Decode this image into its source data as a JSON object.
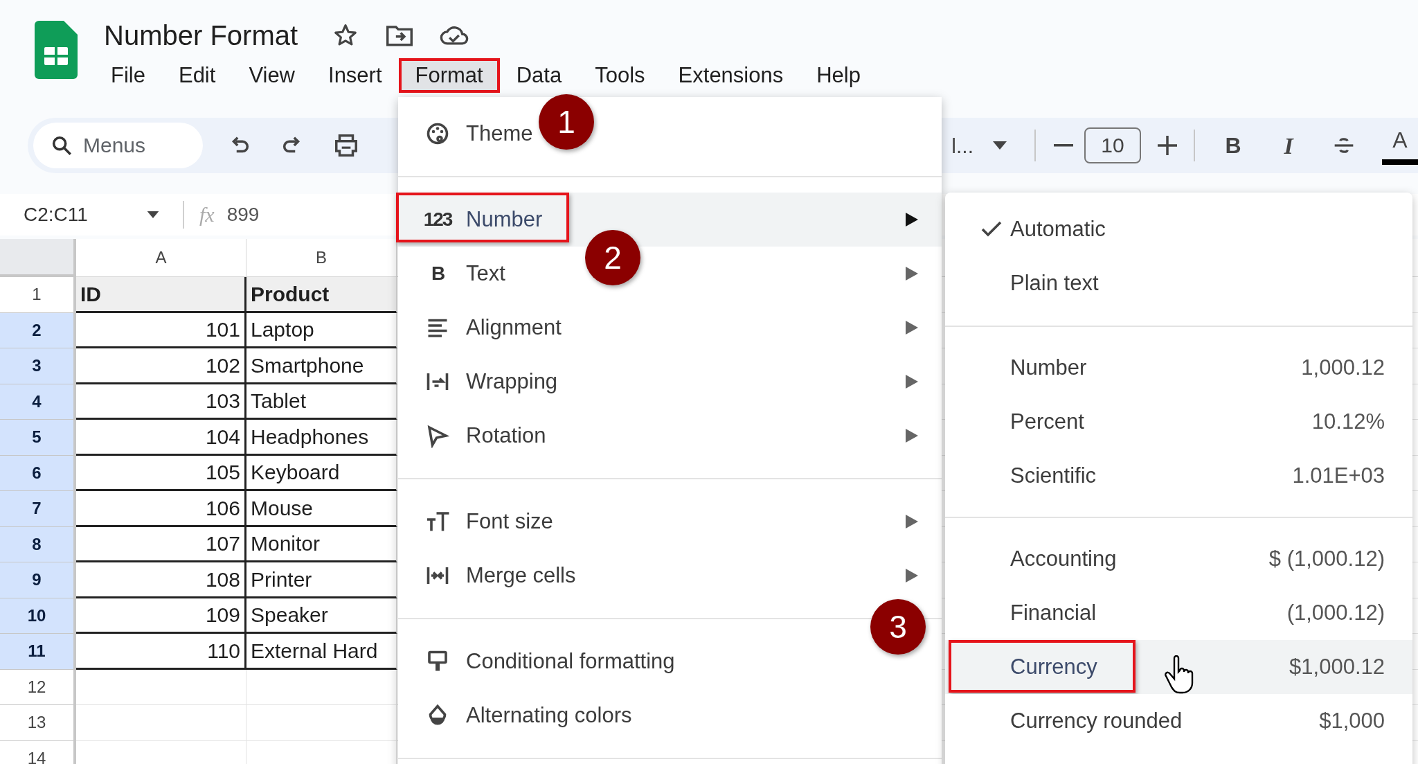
{
  "document": {
    "title": "Number Format"
  },
  "menu_bar": [
    {
      "label": "File",
      "selected": false,
      "highlighted": false
    },
    {
      "label": "Edit",
      "selected": false,
      "highlighted": false
    },
    {
      "label": "View",
      "selected": false,
      "highlighted": false
    },
    {
      "label": "Insert",
      "selected": false,
      "highlighted": false
    },
    {
      "label": "Format",
      "selected": true,
      "highlighted": true
    },
    {
      "label": "Data",
      "selected": false,
      "highlighted": false
    },
    {
      "label": "Tools",
      "selected": false,
      "highlighted": false
    },
    {
      "label": "Extensions",
      "selected": false,
      "highlighted": false
    },
    {
      "label": "Help",
      "selected": false,
      "highlighted": false
    }
  ],
  "toolbar": {
    "search": {
      "placeholder": "Menus"
    },
    "font": {
      "value": "l..."
    },
    "font_size": {
      "value": "10"
    },
    "style_buttons": [
      {
        "kind": "bold",
        "glyph": "B"
      },
      {
        "kind": "italic",
        "glyph": "I"
      },
      {
        "kind": "strikethrough"
      },
      {
        "kind": "text_color",
        "glyph": "A"
      }
    ]
  },
  "formula_bar": {
    "name_box": "C2:C11",
    "fx_label": "fx",
    "formula": "899"
  },
  "sheet": {
    "columns": [
      "A",
      "B"
    ],
    "rows": [
      {
        "number": "1",
        "kind": "header",
        "selected": false,
        "cells": [
          "ID",
          "Product"
        ]
      },
      {
        "number": "2",
        "kind": "data",
        "selected": true,
        "cells": [
          "101",
          "Laptop"
        ]
      },
      {
        "number": "3",
        "kind": "data",
        "selected": true,
        "cells": [
          "102",
          "Smartphone"
        ]
      },
      {
        "number": "4",
        "kind": "data",
        "selected": true,
        "cells": [
          "103",
          "Tablet"
        ]
      },
      {
        "number": "5",
        "kind": "data",
        "selected": true,
        "cells": [
          "104",
          "Headphones"
        ]
      },
      {
        "number": "6",
        "kind": "data",
        "selected": true,
        "cells": [
          "105",
          "Keyboard"
        ]
      },
      {
        "number": "7",
        "kind": "data",
        "selected": true,
        "cells": [
          "106",
          "Mouse"
        ]
      },
      {
        "number": "8",
        "kind": "data",
        "selected": true,
        "cells": [
          "107",
          "Monitor"
        ]
      },
      {
        "number": "9",
        "kind": "data",
        "selected": true,
        "cells": [
          "108",
          "Printer"
        ]
      },
      {
        "number": "10",
        "kind": "data",
        "selected": true,
        "cells": [
          "109",
          "Speaker"
        ]
      },
      {
        "number": "11",
        "kind": "data",
        "selected": true,
        "cells": [
          "110",
          "External Hard"
        ]
      },
      {
        "number": "12",
        "kind": "empty",
        "selected": false
      },
      {
        "number": "13",
        "kind": "empty",
        "selected": false
      },
      {
        "number": "14",
        "kind": "empty",
        "selected": false
      }
    ]
  },
  "format_menu": {
    "sections": [
      [
        {
          "label": "Theme",
          "has_submenu": false,
          "selected": false,
          "highlighted": false
        }
      ],
      [
        {
          "label": "Number",
          "icon_text": "123",
          "has_submenu": true,
          "selected": true,
          "highlighted": true
        },
        {
          "label": "Text",
          "icon_text": "B",
          "has_submenu": true,
          "selected": false,
          "highlighted": false
        },
        {
          "label": "Alignment",
          "has_submenu": true,
          "selected": false,
          "highlighted": false
        },
        {
          "label": "Wrapping",
          "has_submenu": true,
          "selected": false,
          "highlighted": false
        },
        {
          "label": "Rotation",
          "has_submenu": true,
          "selected": false,
          "highlighted": false
        }
      ],
      [
        {
          "label": "Font size",
          "has_submenu": true,
          "selected": false,
          "highlighted": false
        },
        {
          "label": "Merge cells",
          "has_submenu": true,
          "selected": false,
          "highlighted": false
        }
      ],
      [
        {
          "label": "Conditional formatting",
          "has_submenu": false,
          "selected": false,
          "highlighted": false
        },
        {
          "label": "Alternating colors",
          "has_submenu": false,
          "selected": false,
          "highlighted": false
        }
      ]
    ]
  },
  "number_submenu": {
    "sections": [
      [
        {
          "label": "Automatic",
          "checked": true,
          "selected": false,
          "highlighted": false
        },
        {
          "label": "Plain text",
          "checked": false,
          "selected": false,
          "highlighted": false
        }
      ],
      [
        {
          "label": "Number",
          "example": "1,000.12",
          "checked": false,
          "selected": false,
          "highlighted": false
        },
        {
          "label": "Percent",
          "example": "10.12%",
          "checked": false,
          "selected": false,
          "highlighted": false
        },
        {
          "label": "Scientific",
          "example": "1.01E+03",
          "checked": false,
          "selected": false,
          "highlighted": false
        }
      ],
      [
        {
          "label": "Accounting",
          "example": "$ (1,000.12)",
          "checked": false,
          "selected": false,
          "highlighted": false
        },
        {
          "label": "Financial",
          "example": "(1,000.12)",
          "checked": false,
          "selected": false,
          "highlighted": false
        },
        {
          "label": "Currency",
          "example": "$1,000.12",
          "checked": false,
          "selected": true,
          "highlighted": true
        },
        {
          "label": "Currency rounded",
          "example": "$1,000",
          "checked": false,
          "selected": false,
          "highlighted": false
        }
      ]
    ]
  },
  "annotations": [
    {
      "label": "1"
    },
    {
      "label": "2"
    },
    {
      "label": "3"
    }
  ]
}
